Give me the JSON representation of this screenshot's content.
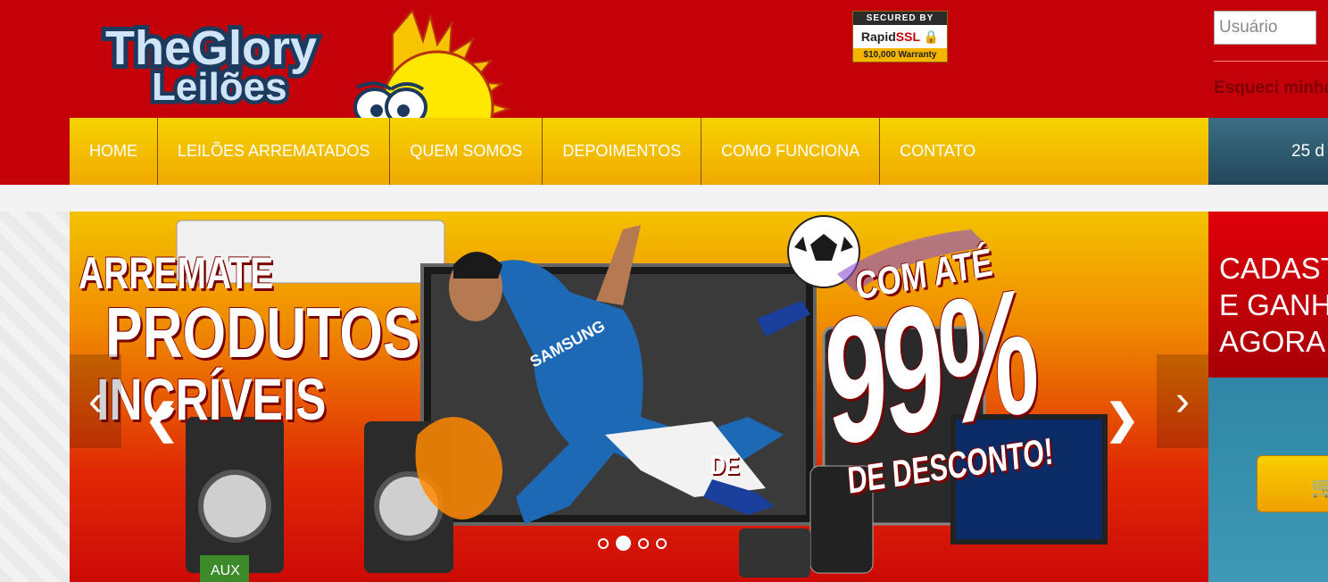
{
  "header": {
    "logo_line1": "TheGlory",
    "logo_line2": "Leilões",
    "ssl_badge": {
      "line1": "SECURED BY",
      "line2_brand": "Rapid",
      "line2_ssl": "SSL",
      "line3": "$10,000 Warranty"
    }
  },
  "login": {
    "username_placeholder": "Usuário",
    "forgot_link": "Esqueci minha senha"
  },
  "nav": {
    "items": [
      "HOME",
      "LEILÕES ARREMATADOS",
      "QUEM SOMOS",
      "DEPOIMENTOS",
      "COMO FUNCIONA",
      "CONTATO"
    ],
    "date_text": "25 d"
  },
  "banner": {
    "text_line1": "ARREMATE",
    "text_line2": "PRODUTOS",
    "text_line3": "INCRÍVEIS",
    "promo_line1": "COM ATÉ",
    "promo_big": "99%",
    "promo_line3": "DE DESCONTO!",
    "promo_de": "DE",
    "shirt_text": "SAMSUNG",
    "aux_label": "AUX",
    "prev_arrow": "‹",
    "next_arrow": "›",
    "slide_count": 4,
    "active_slide": 2
  },
  "side_panel": {
    "lines": [
      "CADASTRE-SE",
      "E GANHE",
      "AGORA"
    ],
    "cart_icon": "cart-icon"
  },
  "colors": {
    "header_red": "#c40008",
    "nav_yellow": "#f6d300",
    "date_bar_blue": "#2f5f75",
    "side_teal": "#3590af"
  }
}
